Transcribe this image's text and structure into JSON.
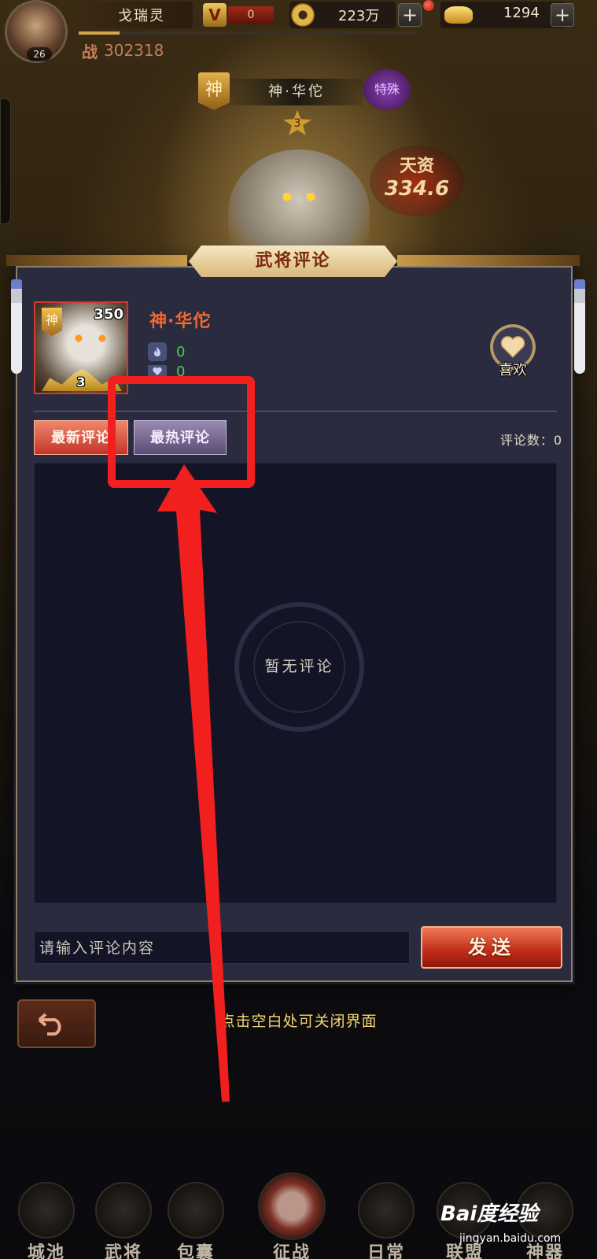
{
  "hud": {
    "player_name": "戈瑞灵",
    "avatar_level": "26",
    "vip_badge": "V",
    "vip_value": "0",
    "coins": "223万",
    "ingots": "1294",
    "plus": "+",
    "power_label": "战",
    "power_value": "302318",
    "exp_progress": 0.12
  },
  "hero_bg": {
    "badge": "神",
    "name": "神·华佗",
    "tag": "特殊",
    "stars": "3",
    "talent_label": "天资",
    "talent_value": "334.6"
  },
  "modal": {
    "title": "武将评论",
    "hero": {
      "badge": "神",
      "level": "350",
      "star_count": "3",
      "name": "神·华佗",
      "stat_fire": "0",
      "stat_heart": "0"
    },
    "like_label": "喜欢",
    "tabs": {
      "latest": "最新评论",
      "hottest": "最热评论"
    },
    "comment_count": "评论数：0",
    "empty_text": "暂无评论",
    "input_placeholder": "请输入评论内容",
    "send_label": "发送"
  },
  "close_hint": "点击空白处可关闭界面",
  "bottom_nav": [
    {
      "label": "城池"
    },
    {
      "label": "武将"
    },
    {
      "label": "包囊"
    },
    {
      "label": "征战"
    },
    {
      "label": "日常"
    },
    {
      "label": "联盟"
    },
    {
      "label": "神器"
    }
  ],
  "watermark": {
    "main": "Bai度经验",
    "sub": "jingyan.baidu.com"
  },
  "colors": {
    "annotation": "#f21f1f",
    "accent_red": "#c3362a",
    "hero_name": "#f06a2c",
    "stat_green": "#49d04a",
    "close_hint": "#f4d470"
  }
}
